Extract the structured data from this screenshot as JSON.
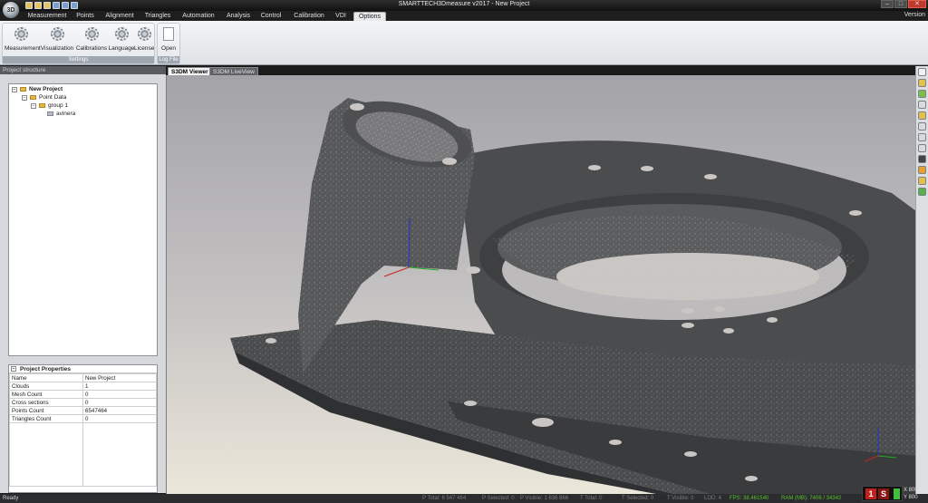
{
  "window": {
    "title": "SMARTTECH3Dmeasure v2017 - New Project",
    "version_label": "Version"
  },
  "ribbon_tabs": [
    "Measurement",
    "Points",
    "Alignment",
    "Triangles",
    "Automation",
    "Analysis",
    "Control",
    "Calibration",
    "VDI",
    "Options"
  ],
  "active_tab": "Options",
  "ribbon": {
    "settings_group": {
      "label": "Settings",
      "buttons": [
        "Measurement",
        "Visualization",
        "Calibrations",
        "Language",
        "License"
      ]
    },
    "logfile_group": {
      "label": "Log File",
      "buttons": [
        "Open"
      ]
    }
  },
  "project_structure": {
    "header": "Project structure",
    "tree": [
      "New Project",
      "Point Data",
      "group 1",
      "avinera"
    ]
  },
  "project_properties": {
    "title": "Project Properties",
    "rows": [
      [
        "Name",
        "New Project"
      ],
      [
        "Clouds",
        "1"
      ],
      [
        "Mesh Count",
        "0"
      ],
      [
        "Cross sections",
        "0"
      ],
      [
        "Points Count",
        "6547464"
      ],
      [
        "Triangles Count",
        "0"
      ]
    ]
  },
  "view_tabs": [
    "S3DM Viewer",
    "S3DM LiveView"
  ],
  "active_view_tab": "S3DM Viewer",
  "status": {
    "ready": "Ready",
    "p_total": "P Total: 6 547 464",
    "p_selected": "P Selected: 0",
    "p_visible": "P Visible: 1 636 866",
    "t_total": "T Total: 0",
    "t_selected": "T Selected: 0",
    "t_visible": "T Visible: 0",
    "lod": "LOD: 4",
    "fps": "FPS: 38.461540",
    "ram": "RAM (MB): 7406 / 34342",
    "rec_number": "1",
    "x": "X 800",
    "y": "Y 800"
  },
  "colors": {
    "accent": "#e5b84b",
    "model": "#4a4b4d",
    "fps": "#58c030",
    "record": "#c0211b"
  }
}
